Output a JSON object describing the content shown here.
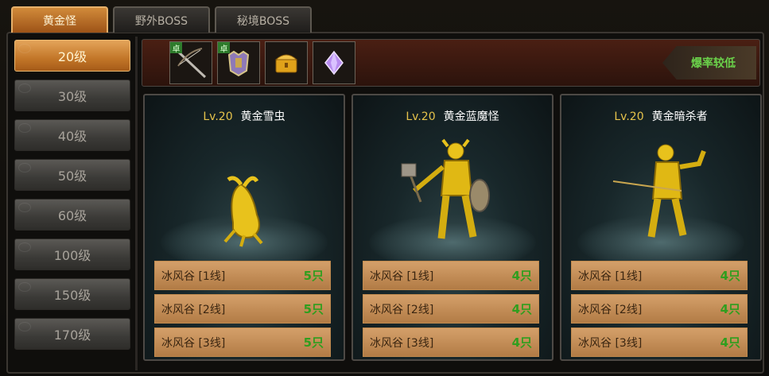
{
  "tabs": [
    {
      "label": "黄金怪",
      "active": true
    },
    {
      "label": "野外BOSS",
      "active": false
    },
    {
      "label": "秘境BOSS",
      "active": false
    }
  ],
  "levels": [
    {
      "label": "20级",
      "active": true
    },
    {
      "label": "30级",
      "active": false
    },
    {
      "label": "40级",
      "active": false
    },
    {
      "label": "50级",
      "active": false
    },
    {
      "label": "60级",
      "active": false
    },
    {
      "label": "100级",
      "active": false
    },
    {
      "label": "150级",
      "active": false
    },
    {
      "label": "170级",
      "active": false
    }
  ],
  "rewards": {
    "items": [
      {
        "icon": "crossbow-icon",
        "badge": "卓"
      },
      {
        "icon": "armor-icon",
        "badge": "卓"
      },
      {
        "icon": "treasure-chest-icon",
        "badge": ""
      },
      {
        "icon": "purple-gem-icon",
        "badge": ""
      }
    ],
    "drop_rate_label": "爆率较低"
  },
  "monsters": [
    {
      "level": "Lv.20",
      "name": "黄金雪虫",
      "spawns": [
        {
          "location": "冰风谷 [1线]",
          "count": "5只"
        },
        {
          "location": "冰风谷 [2线]",
          "count": "5只"
        },
        {
          "location": "冰风谷 [3线]",
          "count": "5只"
        }
      ]
    },
    {
      "level": "Lv.20",
      "name": "黄金蓝魔怪",
      "spawns": [
        {
          "location": "冰风谷 [1线]",
          "count": "4只"
        },
        {
          "location": "冰风谷 [2线]",
          "count": "4只"
        },
        {
          "location": "冰风谷 [3线]",
          "count": "4只"
        }
      ]
    },
    {
      "level": "Lv.20",
      "name": "黄金暗杀者",
      "spawns": [
        {
          "location": "冰风谷 [1线]",
          "count": "4只"
        },
        {
          "location": "冰风谷 [2线]",
          "count": "4只"
        },
        {
          "location": "冰风谷 [3线]",
          "count": "4只"
        }
      ]
    }
  ],
  "colors": {
    "accent": "#c27628",
    "count_green": "#2f9e1e",
    "gold": "#e6c34b"
  }
}
